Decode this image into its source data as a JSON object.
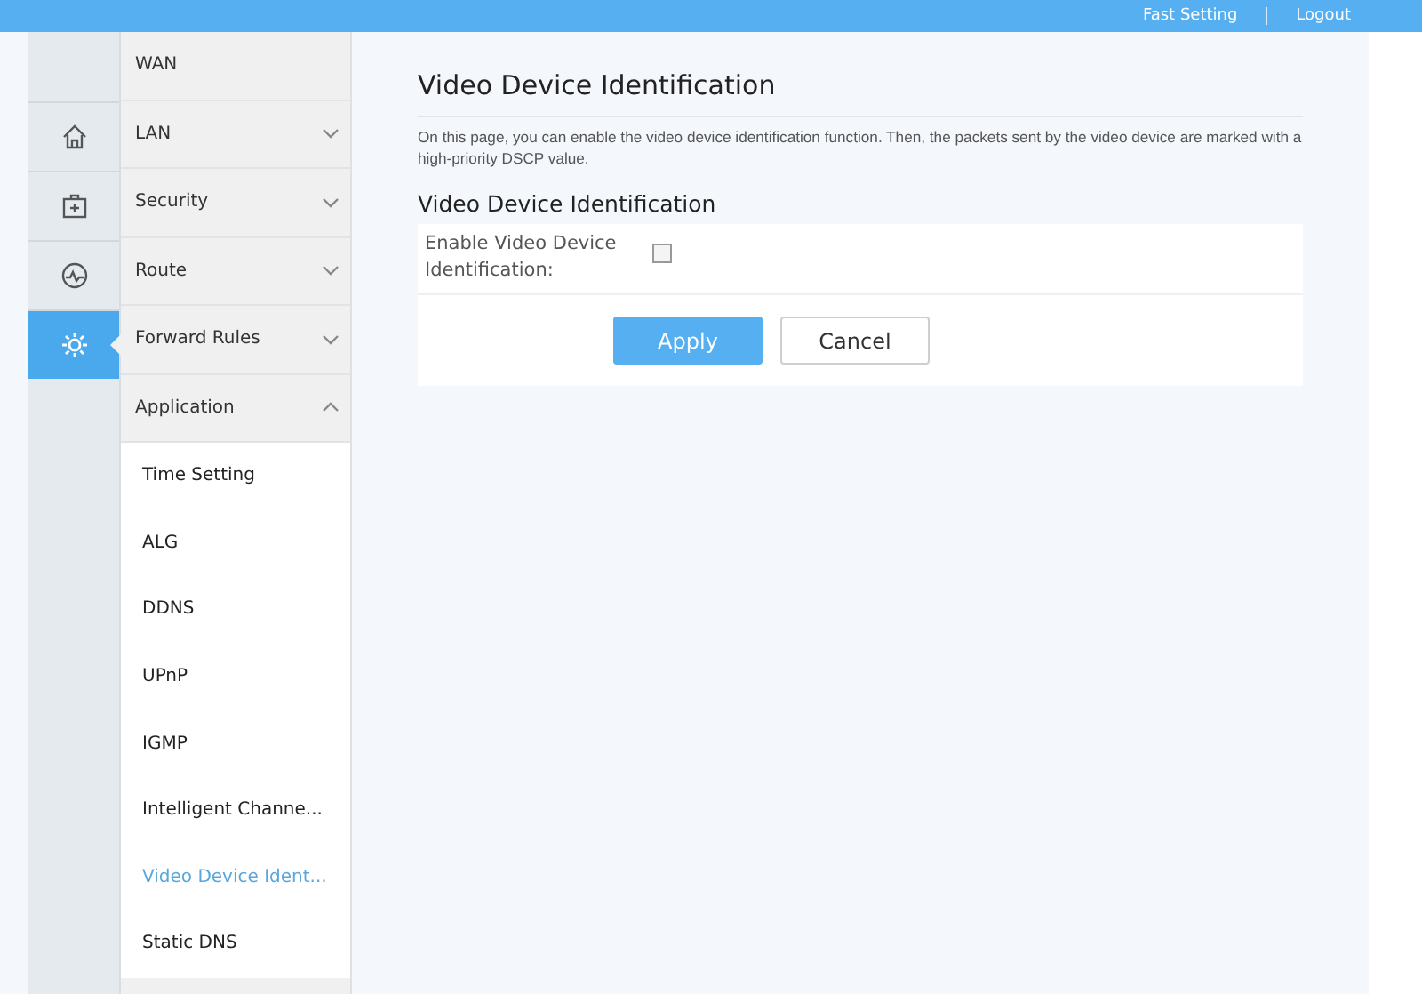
{
  "header": {
    "links": [
      "Fast Setting",
      "Logout"
    ]
  },
  "nav_icons": [
    {
      "selected": false
    },
    {
      "selected": false
    },
    {
      "selected": false
    },
    {
      "selected": true
    }
  ],
  "menu": [
    {
      "label": "WAN",
      "kind": "link"
    },
    {
      "label": "LAN",
      "kind": "group",
      "expanded": false
    },
    {
      "label": "Security",
      "kind": "group",
      "expanded": false
    },
    {
      "label": "Route",
      "kind": "group",
      "expanded": false
    },
    {
      "label": "Forward Rules",
      "kind": "group",
      "expanded": false
    },
    {
      "label": "Application",
      "kind": "group",
      "expanded": true,
      "children": [
        {
          "label": "Time Setting",
          "selected": false
        },
        {
          "label": "ALG",
          "selected": false
        },
        {
          "label": "DDNS",
          "selected": false
        },
        {
          "label": "UPnP",
          "selected": false
        },
        {
          "label": "IGMP",
          "selected": false
        },
        {
          "label": "Intelligent Channe...",
          "selected": false
        },
        {
          "label": "Video Device Ident...",
          "selected": true
        },
        {
          "label": "Static DNS",
          "selected": false
        }
      ]
    }
  ],
  "page": {
    "title": "Video Device Identification",
    "description": "On this page, you can enable the video device identification function. Then, the packets sent by the video device are marked with a high-priority DSCP value.",
    "section_title": "Video Device Identification",
    "field": {
      "label": "Enable Video Device Identification:",
      "checked": false
    },
    "buttons": [
      {
        "label": "Apply",
        "kind": "primary"
      },
      {
        "label": "Cancel",
        "kind": "secondary"
      }
    ]
  }
}
